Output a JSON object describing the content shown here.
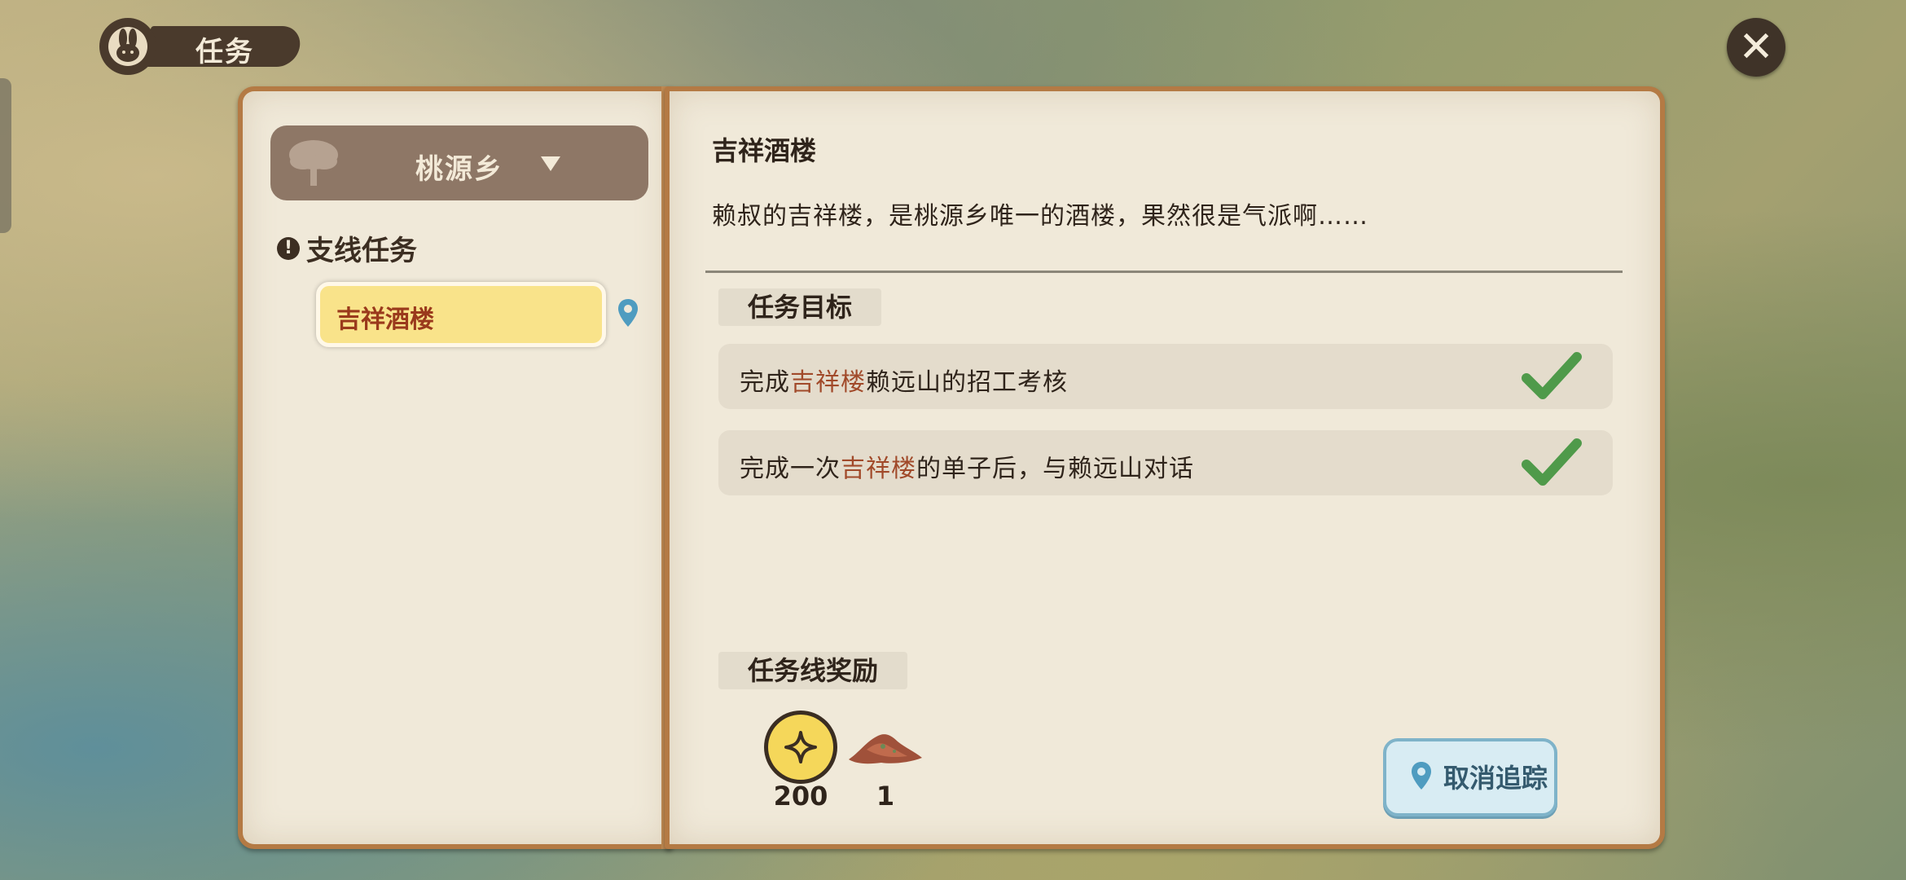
{
  "header": {
    "title": "任务"
  },
  "sidebar": {
    "region": "桃源乡",
    "section_label": "支线任务",
    "quests": [
      {
        "label": "吉祥酒楼",
        "selected": true
      }
    ]
  },
  "detail": {
    "title": "吉祥酒楼",
    "description": "赖叔的吉祥楼，是桃源乡唯一的酒楼，果然很是气派啊……",
    "objectives_label": "任务目标",
    "objectives": [
      {
        "prefix": "完成",
        "highlight": "吉祥楼",
        "suffix": "赖远山的招工考核",
        "completed": true
      },
      {
        "prefix": "完成一次",
        "highlight": "吉祥楼",
        "suffix": "的单子后，与赖远山对话",
        "completed": true
      }
    ],
    "rewards_label": "任务线奖励",
    "rewards": [
      {
        "icon": "coin-icon",
        "count": "200"
      },
      {
        "icon": "ore-icon",
        "count": "1"
      }
    ],
    "untrack_label": "取消追踪"
  },
  "colors": {
    "highlight_text": "#a14a2a",
    "selected_item_bg": "#f9e38a",
    "check_green": "#4f9a4a",
    "book_border": "#b47a44"
  }
}
